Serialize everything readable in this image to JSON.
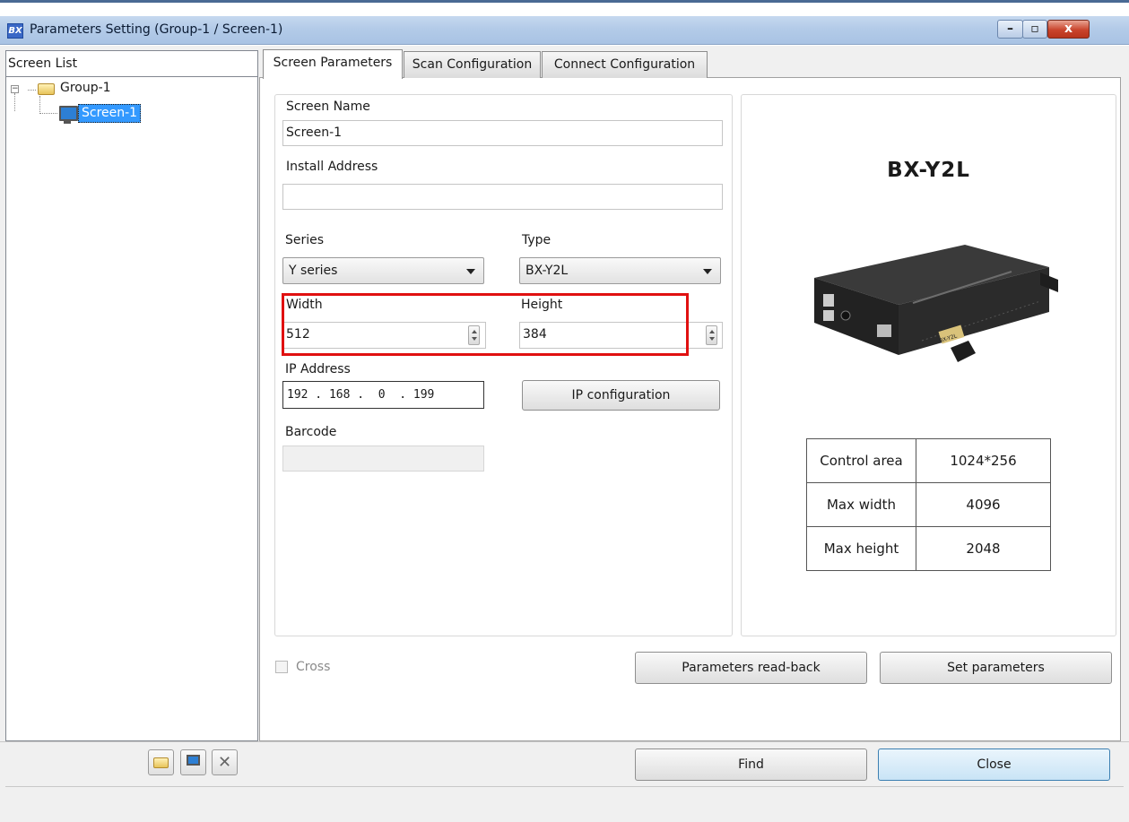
{
  "window": {
    "icon_text": "BX",
    "title": "Parameters Setting  (Group-1 / Screen-1)",
    "min_glyph": "–",
    "max_glyph": "▫",
    "close_glyph": "x"
  },
  "screen_list": {
    "header": "Screen List",
    "group_label": "Group-1",
    "screen_label": "Screen-1",
    "expander": "−"
  },
  "tabs": [
    {
      "label": "Screen Parameters"
    },
    {
      "label": "Scan Configuration"
    },
    {
      "label": "Connect Configuration"
    }
  ],
  "form": {
    "screen_name_label": "Screen Name",
    "screen_name_value": "Screen-1",
    "install_address_label": "Install Address",
    "install_address_value": "",
    "series_label": "Series",
    "series_value": "Y series",
    "type_label": "Type",
    "type_value": "BX-Y2L",
    "width_label": "Width",
    "width_value": "512",
    "height_label": "Height",
    "height_value": "384",
    "ip_label": "IP Address",
    "ip_value": "192 . 168 .  0  . 199",
    "ip_config_button": "IP configuration",
    "barcode_label": "Barcode",
    "barcode_value": ""
  },
  "device": {
    "model": "BX-Y2L",
    "photo_label": "BX-Y2L",
    "table": [
      {
        "key": "Control area",
        "value": "1024*256"
      },
      {
        "key": "Max width",
        "value": "4096"
      },
      {
        "key": "Max height",
        "value": "2048"
      }
    ]
  },
  "cross": {
    "label": "Cross",
    "checked": false
  },
  "buttons": {
    "readback": "Parameters read-back",
    "set": "Set parameters",
    "find": "Find",
    "close": "Close",
    "delete_glyph": "✕"
  },
  "icons": {
    "add_group": "folder-icon",
    "add_screen": "monitor-icon",
    "delete": "close-icon"
  },
  "colors": {
    "selection": "#3399ff",
    "highlight_frame": "#e01010",
    "titlebar": "#b3cbe8"
  }
}
